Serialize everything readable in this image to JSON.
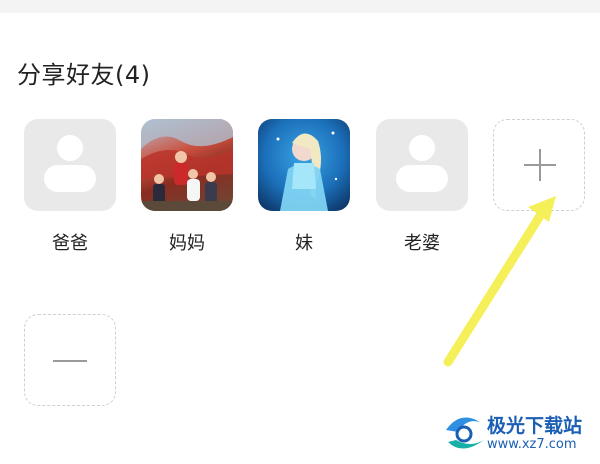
{
  "section_title": "分享好友(4)",
  "friends": [
    {
      "name": "爸爸",
      "avatar": "default-avatar"
    },
    {
      "name": "妈妈",
      "avatar": "family-photo"
    },
    {
      "name": "妹",
      "avatar": "elsa-photo"
    },
    {
      "name": "老婆",
      "avatar": "default-avatar"
    }
  ],
  "add_button_icon": "plus-icon",
  "remove_button_icon": "minus-icon",
  "annotation_arrow_color": "#f5f05a",
  "watermark": {
    "title": "极光下载站",
    "url": "www.xz7.com"
  }
}
